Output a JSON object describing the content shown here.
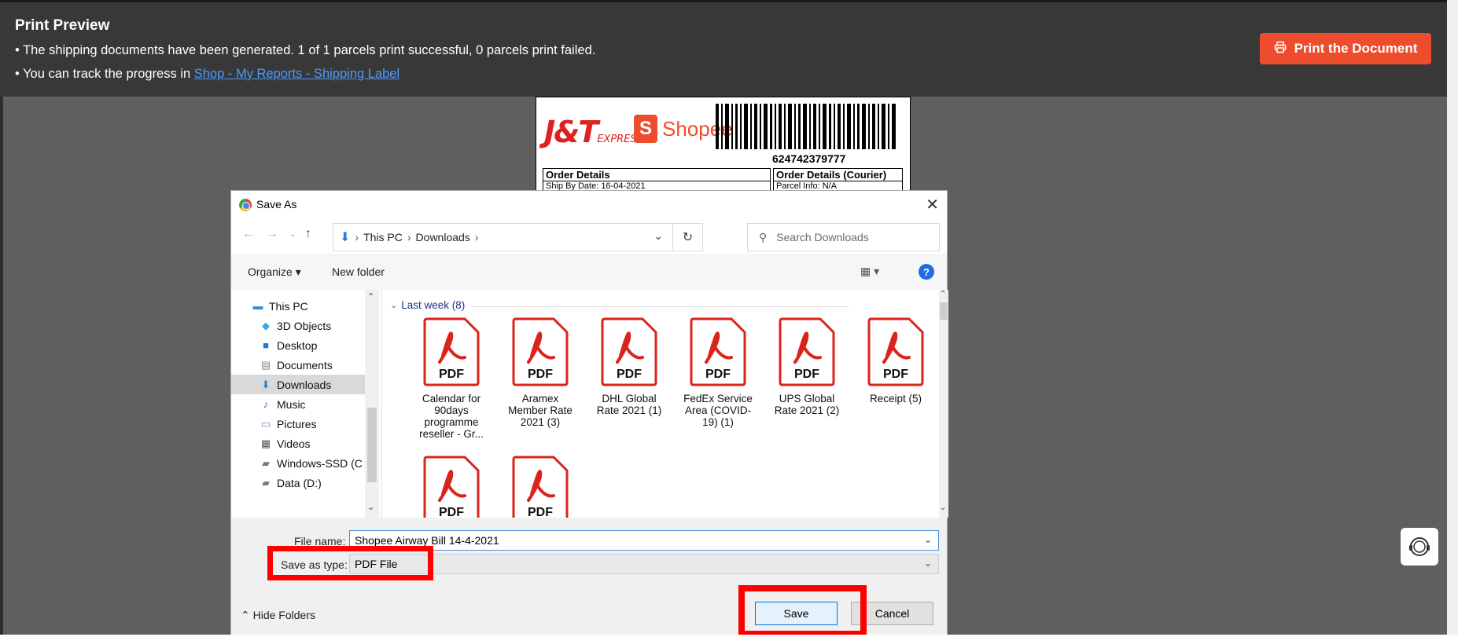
{
  "header": {
    "title": "Print Preview",
    "line1": "• The shipping documents have been generated. 1 of 1 parcels print successful, 0 parcels print failed.",
    "line2_prefix": "• You can track the progress in ",
    "line2_link": "Shop - My Reports - Shipping Label",
    "print_button": "Print the Document"
  },
  "label": {
    "courier_logo": "J&T",
    "courier_logo_sub": "EXPRESS",
    "shop_logo_letter": "S",
    "shop_logo": "Shopee",
    "tracking": "624742379777",
    "order_details": "Order Details",
    "ship_by": "Ship By Date:      16-04-2021",
    "order_details_courier": "Order Details (Courier)",
    "parcel_info": "Parcel Info: N/A"
  },
  "dialog": {
    "title": "Save As",
    "address": {
      "crumbs": [
        "This PC",
        "Downloads"
      ]
    },
    "search_placeholder": "Search Downloads",
    "organize": "Organize ▾",
    "new_folder": "New folder",
    "nav_items": [
      {
        "label": "This PC",
        "icon": "pc-icon"
      },
      {
        "label": "3D Objects",
        "icon": "cube-icon"
      },
      {
        "label": "Desktop",
        "icon": "desktop-icon"
      },
      {
        "label": "Documents",
        "icon": "documents-icon"
      },
      {
        "label": "Downloads",
        "icon": "download-icon"
      },
      {
        "label": "Music",
        "icon": "music-icon"
      },
      {
        "label": "Pictures",
        "icon": "pictures-icon"
      },
      {
        "label": "Videos",
        "icon": "videos-icon"
      },
      {
        "label": "Windows-SSD (C",
        "icon": "drive-icon"
      },
      {
        "label": "Data (D:)",
        "icon": "drive-icon"
      }
    ],
    "group_label": "Last week (8)",
    "files": [
      {
        "name": "Calendar for 90days programme reseller - Gr..."
      },
      {
        "name": "Aramex Member Rate 2021 (3)"
      },
      {
        "name": "DHL Global Rate 2021 (1)"
      },
      {
        "name": "FedEx Service Area (COVID-19) (1)"
      },
      {
        "name": "UPS Global Rate 2021 (2)"
      },
      {
        "name": "Receipt (5)"
      }
    ],
    "pdf_text": "PDF",
    "file_name_label": "File name:",
    "file_name_value": "Shopee Airway Bill 14-4-2021",
    "save_type_label": "Save as type:",
    "save_type_value": "PDF File",
    "hide_folders": "Hide Folders",
    "save": "Save",
    "cancel": "Cancel"
  },
  "colors": {
    "accent": "#ee4d2d",
    "highlight": "#ff0000",
    "pdf_red": "#d9241b"
  }
}
